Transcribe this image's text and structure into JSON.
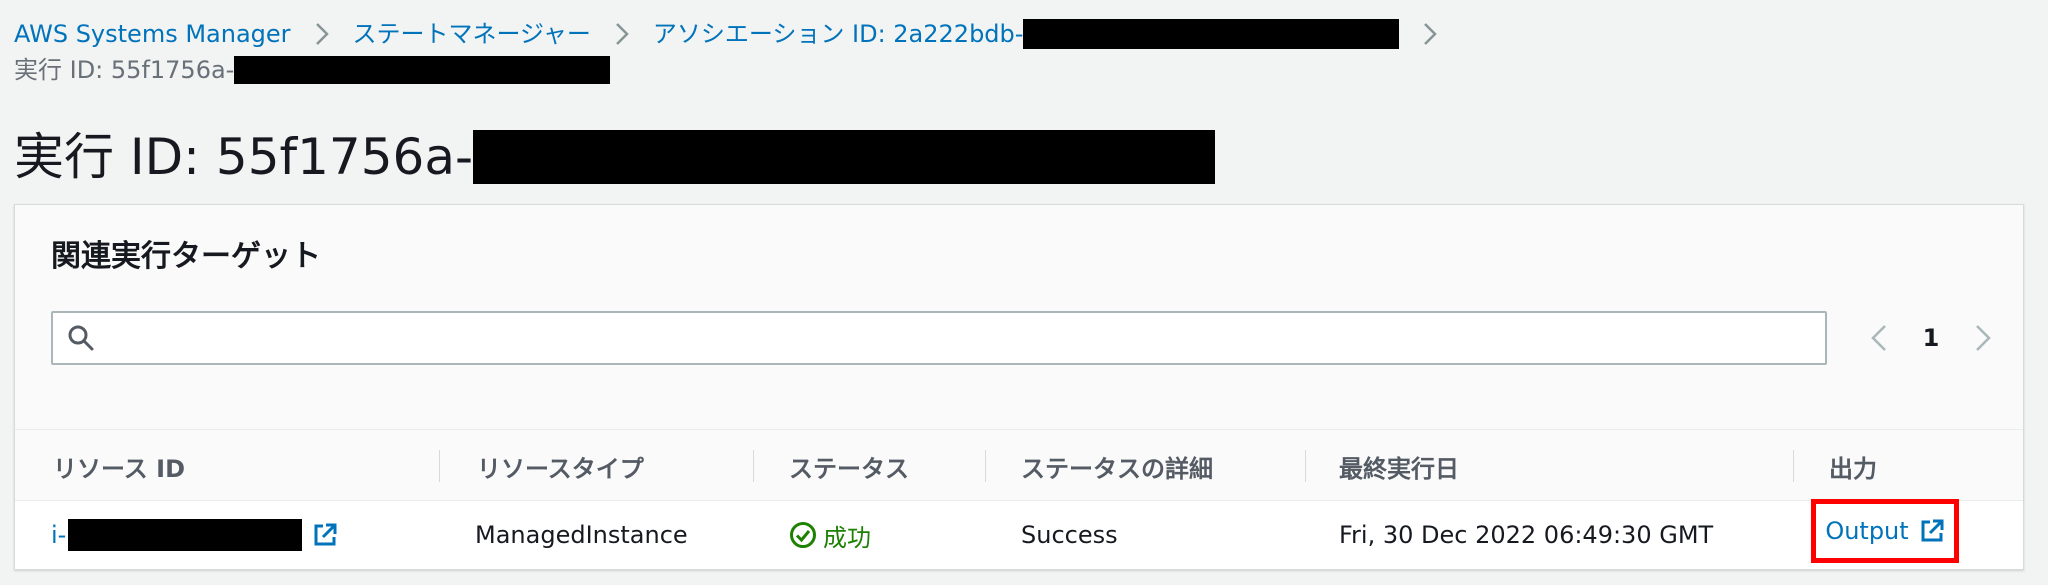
{
  "breadcrumb": {
    "items": [
      {
        "label": "AWS Systems Manager"
      },
      {
        "label": "ステートマネージャー"
      },
      {
        "label": "アソシエーション ID: 2a222bdb-"
      }
    ],
    "current": "実行 ID: 55f1756a-"
  },
  "page": {
    "title": "実行 ID: 55f1756a-"
  },
  "panel": {
    "title": "関連実行ターゲット",
    "search": {
      "value": "",
      "placeholder": ""
    },
    "pagination": {
      "current_page": "1"
    }
  },
  "table": {
    "columns": [
      "リソース ID",
      "リソースタイプ",
      "ステータス",
      "ステータスの詳細",
      "最終実行日",
      "出力"
    ],
    "rows": [
      {
        "resource_id": "i-",
        "resource_type": "ManagedInstance",
        "status": "成功",
        "status_detail": "Success",
        "last_execution": "Fri, 30 Dec 2022 06:49:30 GMT",
        "output": "Output"
      }
    ]
  },
  "colors": {
    "link": "#0073bb",
    "success": "#1d8102",
    "highlight": "#ff0000",
    "background": "#f2f3f3"
  },
  "icons": {
    "breadcrumb_separator": "chevron-right-icon",
    "search": "search-icon",
    "pager_prev": "chevron-left-icon",
    "pager_next": "chevron-right-icon",
    "external_link": "external-link-icon",
    "status": "check-circle-icon"
  }
}
